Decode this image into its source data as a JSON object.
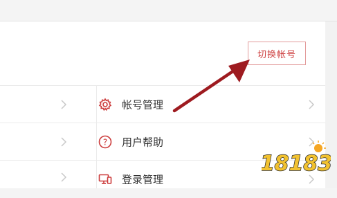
{
  "header": {
    "switch_account_label": "切换帐号"
  },
  "menu": {
    "items": [
      {
        "label": "帐号管理",
        "icon": "gear-icon"
      },
      {
        "label": "用户帮助",
        "icon": "question-circle-icon"
      },
      {
        "label": "登录管理",
        "icon": "devices-icon"
      }
    ]
  },
  "watermark": {
    "text": "18183"
  },
  "colors": {
    "accent": "#cc3b3b",
    "arrow": "#9e1b20",
    "divider": "#ebebeb",
    "chevron": "#c9c9c9"
  }
}
